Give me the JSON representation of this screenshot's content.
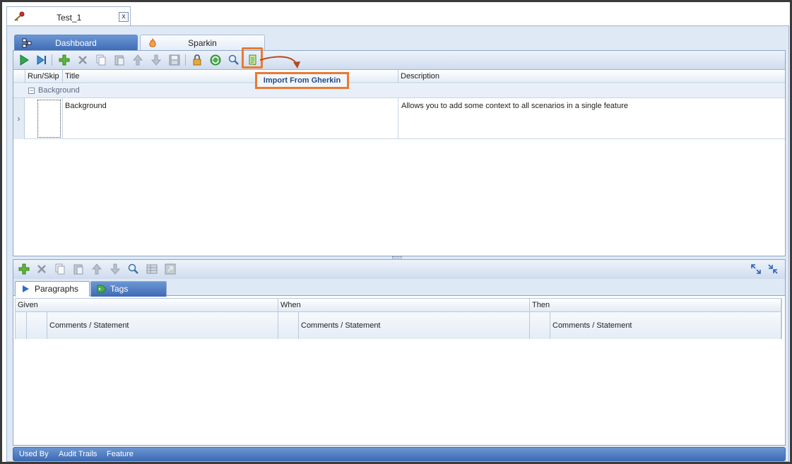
{
  "document_tab": {
    "title": "Test_1",
    "close_label": "x"
  },
  "module_tabs": [
    {
      "label": "Dashboard",
      "active": true
    },
    {
      "label": "Sparkin",
      "active": false
    }
  ],
  "toolbar": {
    "icons": [
      "run-icon",
      "step-icon",
      "add-icon",
      "delete-icon",
      "copy-icon",
      "paste-icon",
      "move-up-icon",
      "move-down-icon",
      "save-icon",
      "lock-icon",
      "refresh-icon",
      "search-icon",
      "import-gherkin-icon"
    ],
    "tooltip": "Import From Gherkin"
  },
  "scenario_grid": {
    "columns": [
      "Run/Skip",
      "Title",
      "Description"
    ],
    "group_label": "Background",
    "rows": [
      {
        "title": "Background",
        "description": "Allows you to add some context to all scenarios in a single feature"
      }
    ]
  },
  "detail_toolbar": {
    "icons": [
      "add-icon",
      "delete-icon",
      "copy-icon",
      "paste-icon",
      "move-up-icon",
      "move-down-icon",
      "search-icon",
      "table-icon",
      "export-icon",
      "expand-icon",
      "collapse-icon"
    ]
  },
  "detail_tabs": [
    {
      "label": "Paragraphs",
      "active": true
    },
    {
      "label": "Tags",
      "active": false
    }
  ],
  "gwt_grid": {
    "columns": [
      "Given",
      "When",
      "Then"
    ],
    "sub_label": "Comments / Statement"
  },
  "status_bar": {
    "items": [
      "Used By",
      "Audit Trails",
      "Feature"
    ]
  },
  "colors": {
    "accent": "#3d6bb4",
    "callout": "#e87b33",
    "highlight_text": "#234b86"
  }
}
